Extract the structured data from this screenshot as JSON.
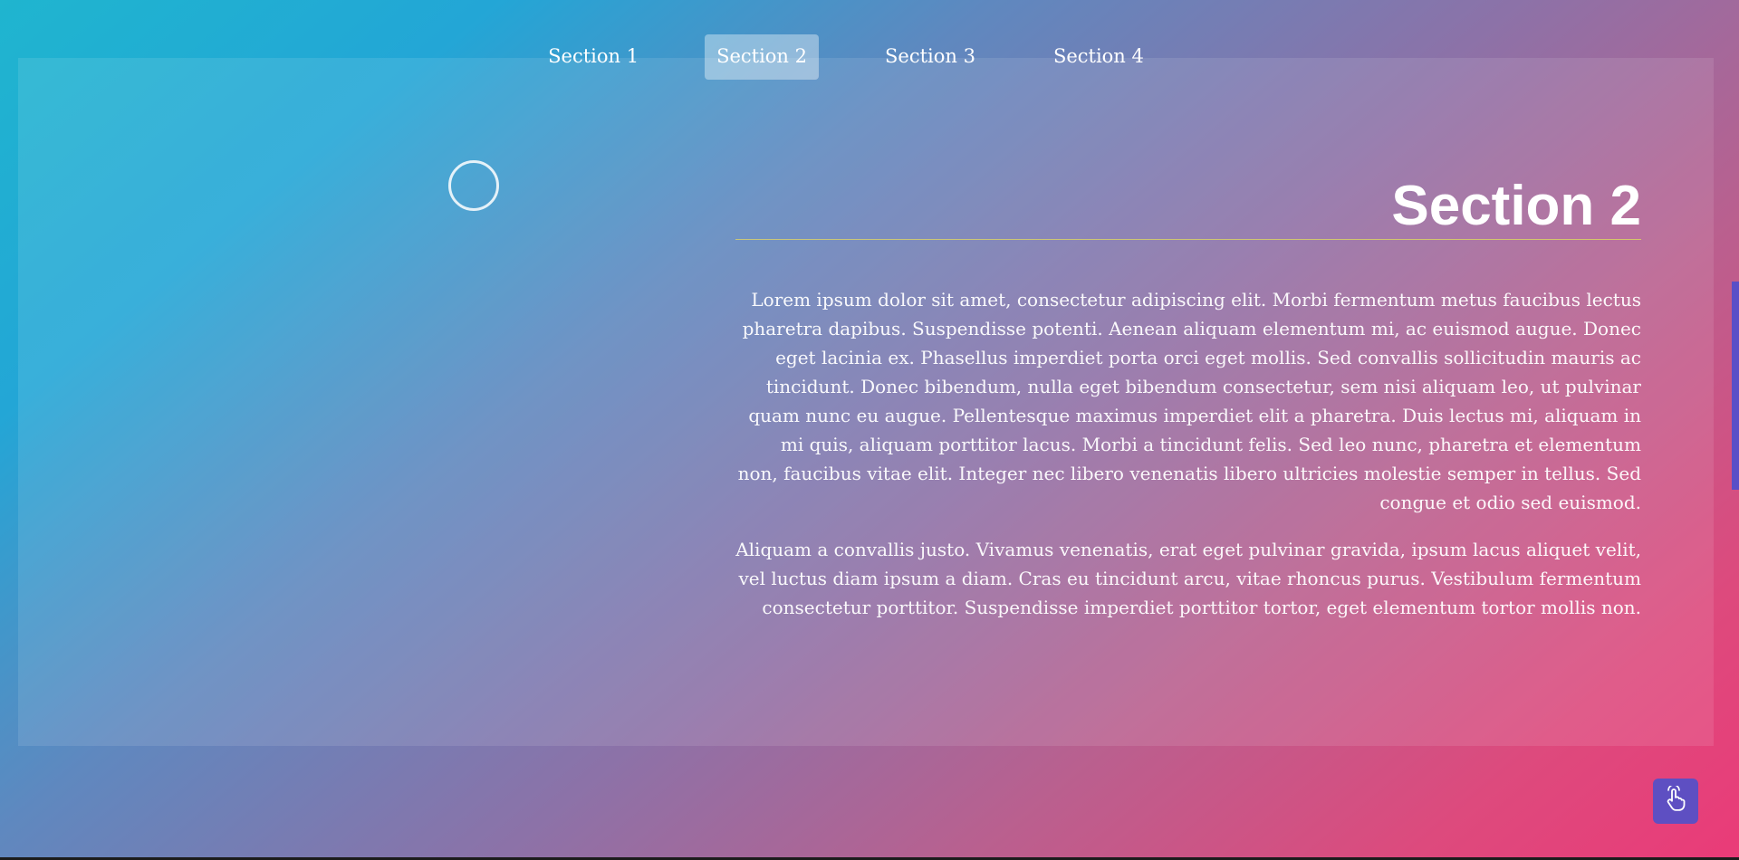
{
  "nav": {
    "tabs": [
      {
        "label": "Section 1",
        "active": false
      },
      {
        "label": "Section 2",
        "active": true
      },
      {
        "label": "Section 3",
        "active": false
      },
      {
        "label": "Section 4",
        "active": false
      }
    ]
  },
  "section": {
    "title": "Section 2",
    "paragraphs": [
      "Lorem ipsum dolor sit amet, consectetur adipiscing elit. Morbi fermentum metus faucibus lectus pharetra dapibus. Suspendisse potenti. Aenean aliquam elementum mi, ac euismod augue. Donec eget lacinia ex. Phasellus imperdiet porta orci eget mollis. Sed convallis sollicitudin mauris ac tincidunt. Donec bibendum, nulla eget bibendum consectetur, sem nisi aliquam leo, ut pulvinar quam nunc eu augue. Pellentesque maximus imperdiet elit a pharetra. Duis lectus mi, aliquam in mi quis, aliquam porttitor lacus. Morbi a tincidunt felis. Sed leo nunc, pharetra et elementum non, faucibus vitae elit. Integer nec libero venenatis libero ultricies molestie semper in tellus. Sed congue et odio sed euismod.",
      "Aliquam a convallis justo. Vivamus venenatis, erat eget pulvinar gravida, ipsum lacus aliquet velit, vel luctus diam ipsum a diam. Cras eu tincidunt arcu, vitae rhoncus purus. Vestibulum fermentum consectetur porttitor. Suspendisse imperdiet porttitor tortor, eget elementum tortor mollis non."
    ]
  },
  "icons": {
    "touch_button": "touch-pointer-icon",
    "marker": "circle-outline-icon"
  },
  "colors": {
    "gradient_start": "#1fb5cf",
    "gradient_end": "#ea3b78",
    "accent": "#5e4fc2"
  }
}
